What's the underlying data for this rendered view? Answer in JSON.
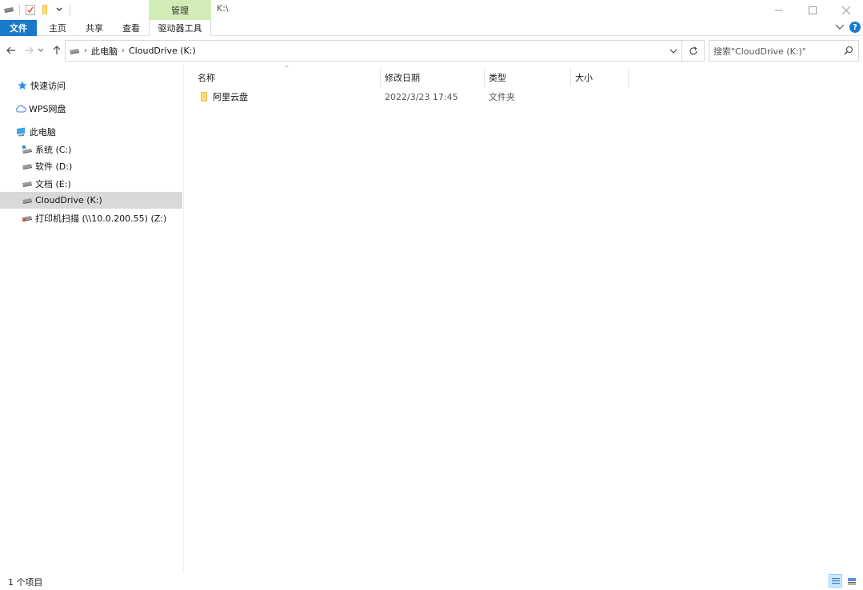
{
  "window": {
    "title": "K:\\",
    "context_group": "管理",
    "controls": {
      "minimize": "—",
      "maximize": "☐",
      "close": "✕"
    }
  },
  "ribbon": {
    "tabs": [
      {
        "label": "文件",
        "active": true
      },
      {
        "label": "主页"
      },
      {
        "label": "共享"
      },
      {
        "label": "查看"
      },
      {
        "label": "驱动器工具",
        "contextual": true
      }
    ],
    "collapse_icon": "chevron-down-icon",
    "help": "?"
  },
  "navigation": {
    "breadcrumb": [
      "此电脑",
      "CloudDrive (K:)"
    ],
    "search_placeholder": "搜索\"CloudDrive (K:)\""
  },
  "sidebar": {
    "items": [
      {
        "label": "快速访问",
        "icon": "star-icon"
      },
      {
        "label": "WPS网盘",
        "icon": "cloud-icon"
      },
      {
        "label": "此电脑",
        "icon": "computer-icon"
      },
      {
        "label": "系统 (C:)",
        "icon": "system-drive-icon"
      },
      {
        "label": "软件 (D:)",
        "icon": "drive-icon"
      },
      {
        "label": "文档 (E:)",
        "icon": "drive-icon"
      },
      {
        "label": "CloudDrive (K:)",
        "icon": "drive-icon",
        "selected": true
      },
      {
        "label": "打印机扫描 (\\\\10.0.200.55) (Z:)",
        "icon": "network-drive-disconnected-icon"
      }
    ]
  },
  "content": {
    "columns": [
      "名称",
      "修改日期",
      "类型",
      "大小"
    ],
    "sort_indicator": "^",
    "rows": [
      {
        "name": "阿里云盘",
        "modified": "2022/3/23 17:45",
        "type": "文件夹",
        "size": ""
      }
    ]
  },
  "statusbar": {
    "item_count": "1 个项目"
  },
  "colors": {
    "file_tab": "#1979ca",
    "context_group": "#d2ecb7",
    "selection": "#d9d9d9",
    "folder": "#f5c44e"
  }
}
